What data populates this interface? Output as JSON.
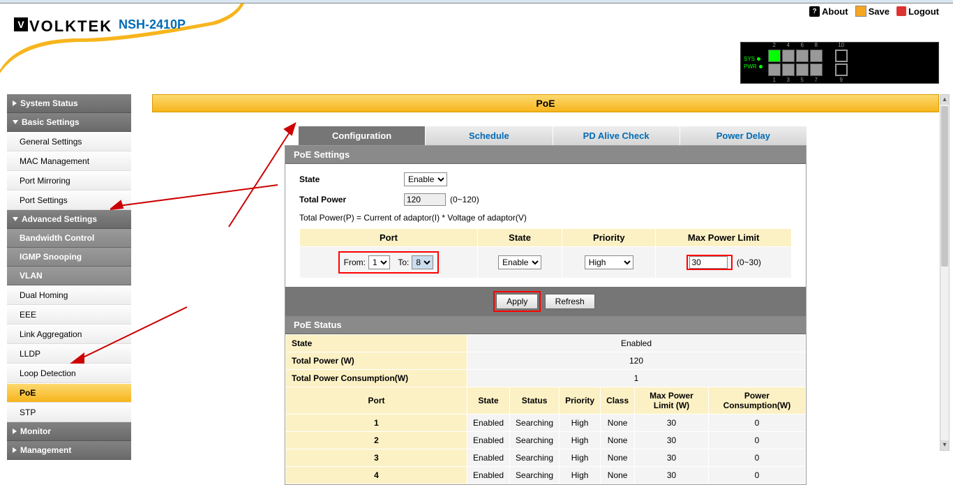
{
  "brand": {
    "name": "VOLKTEK",
    "model": "NSH-2410P"
  },
  "top_links": {
    "about": "About",
    "save": "Save",
    "logout": "Logout"
  },
  "diagram": {
    "sys": "SYS",
    "pwr": "PWR",
    "top_ports": [
      "2",
      "4",
      "6",
      "8"
    ],
    "bottom_ports": [
      "1",
      "3",
      "5",
      "7"
    ],
    "uplink_top": "10",
    "uplink_bot": "9"
  },
  "sidebar": {
    "system_status": "System Status",
    "basic_settings": "Basic Settings",
    "basic_items": [
      "General Settings",
      "MAC Management",
      "Port Mirroring",
      "Port Settings"
    ],
    "advanced_settings": "Advanced Settings",
    "adv_groups": [
      "Bandwidth Control",
      "IGMP Snooping",
      "VLAN"
    ],
    "adv_items": [
      "Dual Homing",
      "EEE",
      "Link Aggregation",
      "LLDP",
      "Loop Detection",
      "PoE",
      "STP"
    ],
    "monitor": "Monitor",
    "management": "Management"
  },
  "page_title": "PoE",
  "tabs": {
    "configuration": "Configuration",
    "schedule": "Schedule",
    "pd": "PD Alive Check",
    "delay": "Power Delay"
  },
  "sections": {
    "settings": "PoE Settings",
    "status": "PoE Status"
  },
  "form": {
    "state_label": "State",
    "state_value": "Enable",
    "total_power_label": "Total Power",
    "total_power_value": "120",
    "total_power_hint": "(0~120)",
    "formula": "Total Power(P) = Current of adaptor(I) * Voltage of adaptor(V)"
  },
  "config_headers": {
    "port": "Port",
    "state": "State",
    "priority": "Priority",
    "max": "Max Power Limit"
  },
  "port_range": {
    "from_label": "From:",
    "from_value": "1",
    "to_label": "To:",
    "to_value": "8"
  },
  "port_state": "Enable",
  "port_priority": "High",
  "port_max": "30",
  "port_max_hint": "(0~30)",
  "buttons": {
    "apply": "Apply",
    "refresh": "Refresh"
  },
  "status": {
    "state_label": "State",
    "state_value": "Enabled",
    "total_power_label": "Total Power (W)",
    "total_power_value": "120",
    "consumption_label": "Total Power Consumption(W)",
    "consumption_value": "1",
    "col_port": "Port",
    "col_state": "State",
    "col_status": "Status",
    "col_priority": "Priority",
    "col_class": "Class",
    "col_max": "Max Power Limit (W)",
    "col_cons": "Power Consumption(W)",
    "rows": [
      {
        "port": "1",
        "state": "Enabled",
        "status": "Searching",
        "priority": "High",
        "class": "None",
        "max": "30",
        "cons": "0"
      },
      {
        "port": "2",
        "state": "Enabled",
        "status": "Searching",
        "priority": "High",
        "class": "None",
        "max": "30",
        "cons": "0"
      },
      {
        "port": "3",
        "state": "Enabled",
        "status": "Searching",
        "priority": "High",
        "class": "None",
        "max": "30",
        "cons": "0"
      },
      {
        "port": "4",
        "state": "Enabled",
        "status": "Searching",
        "priority": "High",
        "class": "None",
        "max": "30",
        "cons": "0"
      }
    ]
  }
}
